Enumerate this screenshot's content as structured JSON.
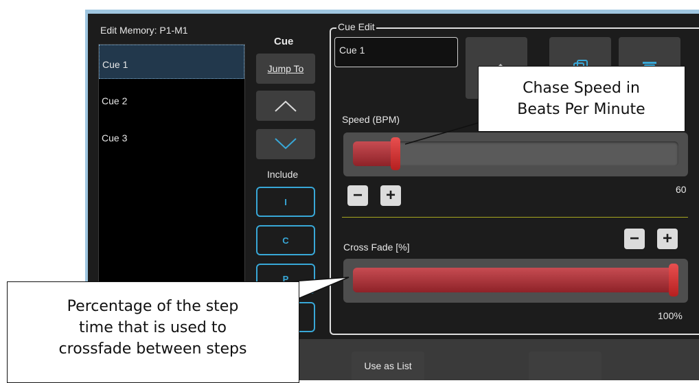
{
  "window": {
    "title": "Edit Memory: P1-M1"
  },
  "cue_column": {
    "header": "Cue",
    "jump_to_label": "Jump To",
    "include_label": "Include",
    "include_buttons": [
      "I",
      "C",
      "P"
    ]
  },
  "cue_list": [
    "Cue 1",
    "Cue 2",
    "Cue 3"
  ],
  "cue_edit": {
    "legend": "Cue Edit",
    "name_value": "Cue 1",
    "speed": {
      "label": "Speed (BPM)",
      "value": "60",
      "level": 0.12
    },
    "crossfade": {
      "label": "Cross Fade [%]",
      "value": "100%",
      "level": 1.0
    },
    "minus_label": "−",
    "plus_label": "+"
  },
  "bottom_bar": {
    "use_as_list_label": "Use as List"
  },
  "callouts": {
    "chase_speed": [
      "Chase Speed in",
      "Beats Per Minute"
    ],
    "crossfade": [
      "Percentage of the step",
      "time that is used to",
      "crossfade between steps"
    ]
  },
  "colors": {
    "accent": "#38a8d8",
    "slider_fill": "#b0333a",
    "divider": "#a8a820",
    "panel_bg": "#1c1c1c"
  }
}
